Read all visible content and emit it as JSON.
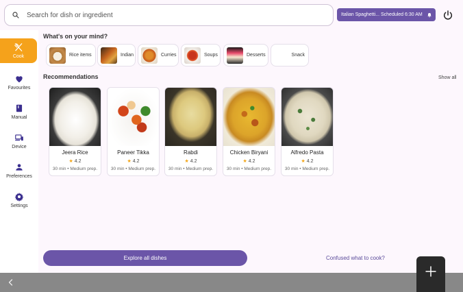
{
  "search": {
    "placeholder": "Search for dish or ingredient"
  },
  "schedule": {
    "text": "Italian Spaghetti...  Scheduled 6:30 AM",
    "color": "#6b55a8"
  },
  "sidebar": {
    "items": [
      {
        "label": "Cook",
        "icon": "fork-knife-icon",
        "active": true
      },
      {
        "label": "Favourites",
        "icon": "heart-icon",
        "active": false
      },
      {
        "label": "Manual",
        "icon": "book-icon",
        "active": false
      },
      {
        "label": "Device",
        "icon": "devices-icon",
        "active": false
      },
      {
        "label": "Preferences",
        "icon": "person-icon",
        "active": false
      },
      {
        "label": "Settings",
        "icon": "gear-icon",
        "active": false
      }
    ],
    "accent": "#f5a21b"
  },
  "mind": {
    "title": "What's on your mind?",
    "chips": [
      {
        "label": "Rice items"
      },
      {
        "label": "Indian"
      },
      {
        "label": "Curries"
      },
      {
        "label": "Soups"
      },
      {
        "label": "Desserts"
      },
      {
        "label": "Snack"
      }
    ]
  },
  "recommendations": {
    "title": "Recommendations",
    "show_all": "Show all",
    "cards": [
      {
        "name": "Jeera Rice",
        "rating": "4.2",
        "meta": "30 min • Medium prep."
      },
      {
        "name": "Paneer Tikka",
        "rating": "4.2",
        "meta": "30 min • Medium prep."
      },
      {
        "name": "Rabdi",
        "rating": "4.2",
        "meta": "30 min • Medium prep."
      },
      {
        "name": "Chicken Biryani",
        "rating": "4.2",
        "meta": "30 min • Medium prep."
      },
      {
        "name": "Alfredo Pasta",
        "rating": "4.2",
        "meta": "30 min • Medium prep."
      }
    ]
  },
  "footer": {
    "explore": "Explore all dishes",
    "confused": "Confused what to cook?"
  }
}
